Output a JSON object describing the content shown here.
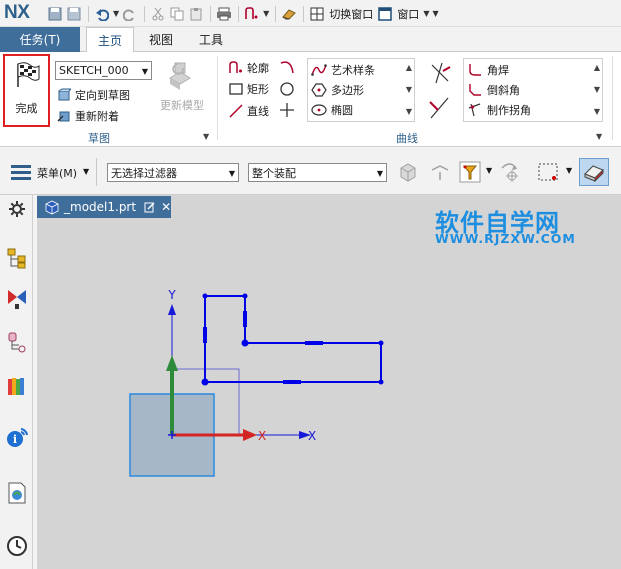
{
  "app": {
    "logo": "NX"
  },
  "quick_access": {
    "switch_window": "切换窗口",
    "window": "窗口"
  },
  "ribbon_tabs": [
    {
      "label": "任务(T)"
    },
    {
      "label": "主页"
    },
    {
      "label": "视图"
    },
    {
      "label": "工具"
    }
  ],
  "sketch_group": {
    "finish_label": "完成",
    "sketch_name": "SKETCH_000",
    "orient_to_sketch": "定向到草图",
    "reattach": "重新附着",
    "update_model": "更新模型",
    "group_label": "草图"
  },
  "curve_group": {
    "profile": "轮廓",
    "rectangle": "矩形",
    "line": "直线",
    "studio_spline": "艺术样条",
    "polygon": "多边形",
    "ellipse": "椭圆",
    "fillet": "角焊",
    "chamfer": "倒斜角",
    "make_corner": "制作拐角",
    "group_label": "曲线"
  },
  "command_bar": {
    "menu": "菜单(M)",
    "filter": "无选择过滤器",
    "scope": "整个装配"
  },
  "document": {
    "tab_label": "_model1.prt"
  },
  "watermark": {
    "title": "软件自学网",
    "url": "WWW.RJZXW.COM"
  },
  "axes": {
    "y_label": "Y",
    "x_label_red": "X",
    "x_label_blue": "X"
  },
  "colors": {
    "tab_blue": "#3f6e9b",
    "sketch_blue": "#0000e6",
    "axis_green": "#2e8b3a",
    "axis_red": "#d42424",
    "highlight_red": "#e02020",
    "watermark_blue": "#1e8fe0"
  }
}
